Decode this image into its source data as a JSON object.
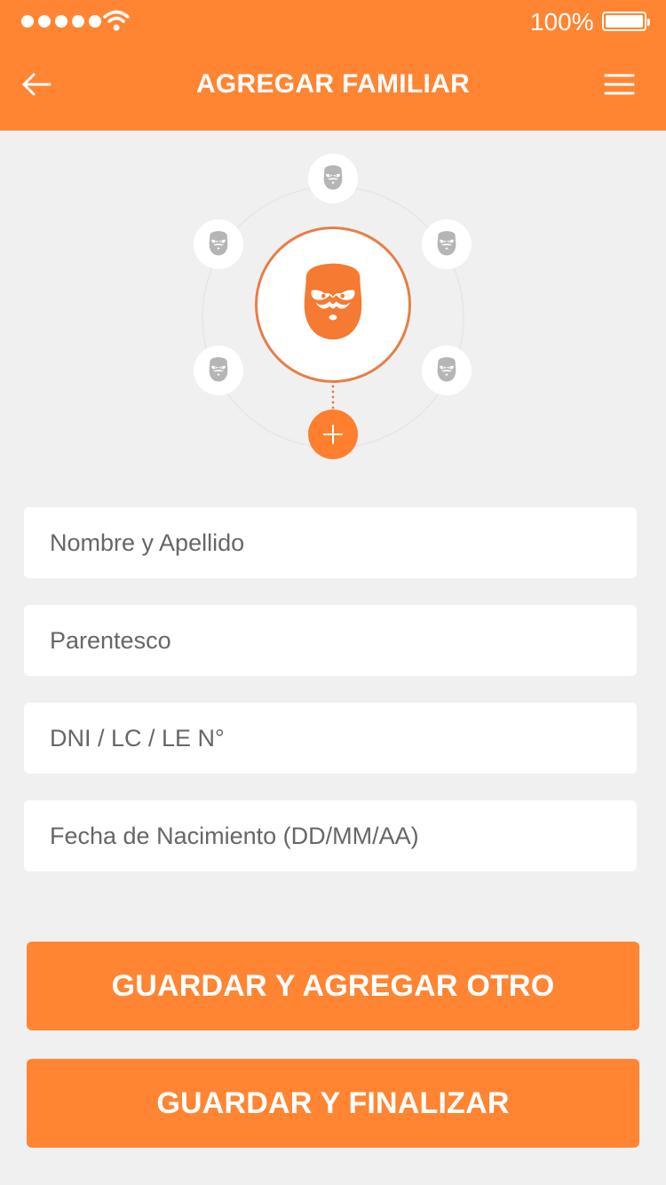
{
  "status_bar": {
    "signal_icon": "signal-dots-icon",
    "wifi_icon": "wifi-icon",
    "battery_percent": "100%",
    "battery_icon": "battery-full-icon"
  },
  "header": {
    "title": "AGREGAR FAMILIAR",
    "back_icon": "arrow-left-icon",
    "menu_icon": "hamburger-menu-icon",
    "background_color": "#ff8533"
  },
  "avatars": {
    "main_icon": "bearded-face-icon",
    "family_icons": [
      "bearded-face-icon",
      "bearded-face-icon",
      "bearded-face-icon",
      "bearded-face-icon",
      "bearded-face-icon"
    ],
    "add_icon": "plus-icon",
    "accent_color": "#ff7f2e"
  },
  "form": {
    "name_placeholder": "Nombre y Apellido",
    "relationship_placeholder": "Parentesco",
    "id_placeholder": "DNI / LC / LE N°",
    "birthdate_placeholder": "Fecha de Nacimiento (DD/MM/AA)"
  },
  "actions": {
    "save_add_label": "GUARDAR Y AGREGAR OTRO",
    "save_finish_label": "GUARDAR Y FINALIZAR"
  }
}
